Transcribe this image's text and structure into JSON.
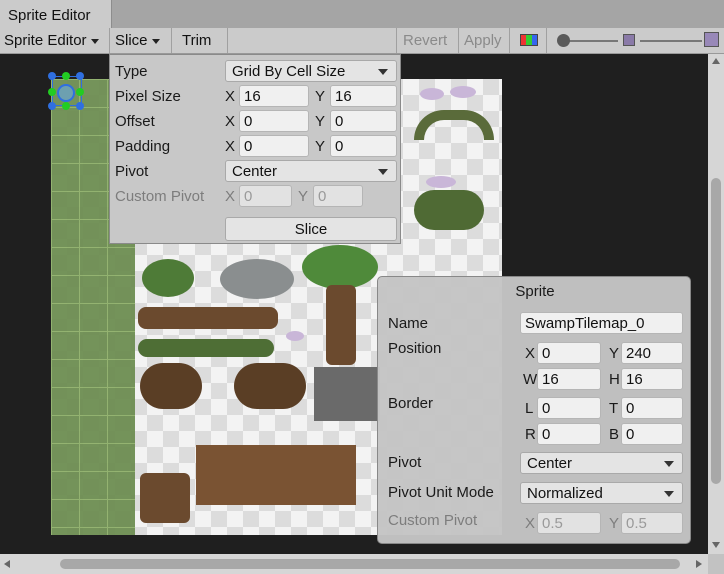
{
  "window": {
    "tab_title": "Sprite Editor"
  },
  "toolbar": {
    "mode_label": "Sprite Editor",
    "slice_label": "Slice",
    "trim_label": "Trim",
    "revert_label": "Revert",
    "apply_label": "Apply",
    "zoom_level": 0.0,
    "mip_level": 1.0
  },
  "slice_panel": {
    "type_label": "Type",
    "type_value": "Grid By Cell Size",
    "pixel_size_label": "Pixel Size",
    "pixel_size_x": "16",
    "pixel_size_y": "16",
    "offset_label": "Offset",
    "offset_x": "0",
    "offset_y": "0",
    "padding_label": "Padding",
    "padding_x": "0",
    "padding_y": "0",
    "pivot_label": "Pivot",
    "pivot_value": "Center",
    "custom_pivot_label": "Custom Pivot",
    "custom_pivot_x": "0",
    "custom_pivot_y": "0",
    "x_label": "X",
    "y_label": "Y",
    "slice_button": "Slice"
  },
  "sprite_panel": {
    "title": "Sprite",
    "name_label": "Name",
    "name_value": "SwampTilemap_0",
    "position_label": "Position",
    "pos_x": "0",
    "pos_y": "240",
    "pos_w": "16",
    "pos_h": "16",
    "border_label": "Border",
    "border_l": "0",
    "border_t": "0",
    "border_r": "0",
    "border_b": "0",
    "pivot_label": "Pivot",
    "pivot_value": "Center",
    "pivot_unit_label": "Pivot Unit Mode",
    "pivot_unit_value": "Normalized",
    "custom_pivot_label": "Custom Pivot",
    "custom_pivot_x": "0.5",
    "custom_pivot_y": "0.5",
    "x": "X",
    "y": "Y",
    "w": "W",
    "h": "H",
    "l": "L",
    "t": "T",
    "r": "R",
    "b": "B"
  },
  "colors": {
    "canvas": "#1f1f1f",
    "grass": "#6e8e52",
    "selection": "#2f6fe0",
    "selection_handle": "#22cc22"
  }
}
